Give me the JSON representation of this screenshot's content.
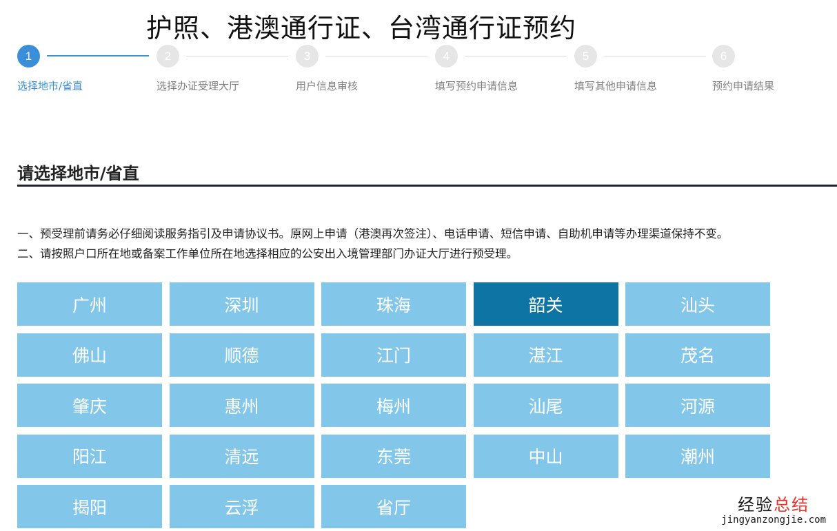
{
  "header": {
    "title": "护照、港澳通行证、台湾通行证预约"
  },
  "steps": [
    {
      "number": "1",
      "label": "选择地市/省直",
      "active": true
    },
    {
      "number": "2",
      "label": "选择办证受理大厅",
      "active": false
    },
    {
      "number": "3",
      "label": "用户信息审核",
      "active": false
    },
    {
      "number": "4",
      "label": "填写预约申请信息",
      "active": false
    },
    {
      "number": "5",
      "label": "填写其他申请信息",
      "active": false
    },
    {
      "number": "6",
      "label": "预约申请结果",
      "active": false
    }
  ],
  "section": {
    "title": "请选择地市/省直",
    "notices": [
      "一、预受理前请务必仔细阅读服务指引及申请协议书。原网上申请（港澳再次签注）、电话申请、短信申请、自助机申请等办理渠道保持不变。",
      "二、请按照户口所在地或备案工作单位所在地选择相应的公安出入境管理部门办证大厅进行预受理。"
    ]
  },
  "cities": [
    "广州",
    "深圳",
    "珠海",
    "韶关",
    "汕头",
    "佛山",
    "顺德",
    "江门",
    "湛江",
    "茂名",
    "肇庆",
    "惠州",
    "梅州",
    "汕尾",
    "河源",
    "阳江",
    "清远",
    "东莞",
    "中山",
    "潮州",
    "揭阳",
    "云浮",
    "省厅"
  ],
  "selected_city": "韶关",
  "watermark": {
    "cn_main": "经验",
    "cn_accent": "总结",
    "url": "jingyanzongjie.com"
  },
  "colors": {
    "accent": "#3b8ed8",
    "city_button": "#82c6e9",
    "city_button_selected": "#0e74a3",
    "inactive_step": "#e6e6e6"
  }
}
